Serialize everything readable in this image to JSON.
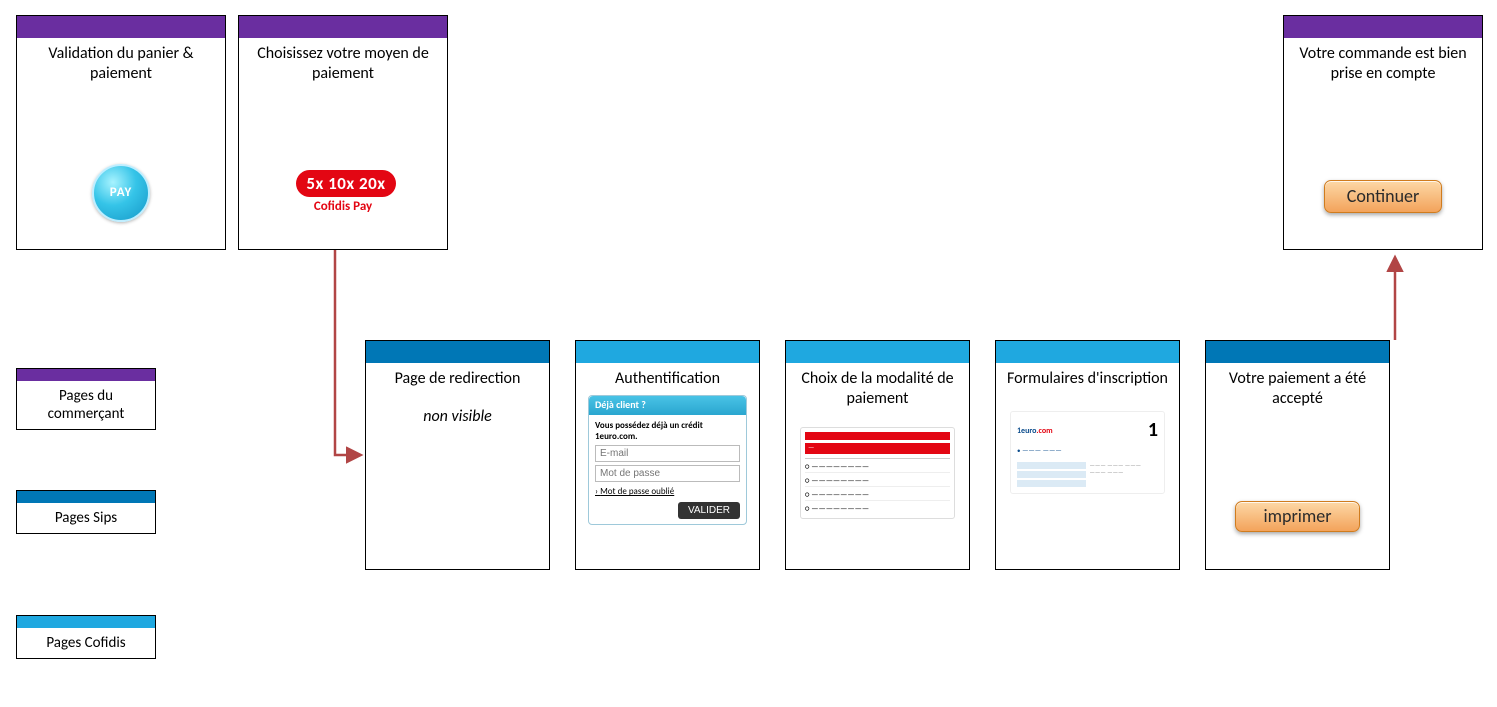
{
  "legend": {
    "merchant": "Pages du commerçant",
    "sips": "Pages Sips",
    "cofidis": "Pages Cofidis"
  },
  "topCards": {
    "validation": "Validation du panier & paiement",
    "choose": "Choisissez votre moyen de paiement",
    "confirm": "Votre commande est bien prise en compte",
    "continue": "Continuer"
  },
  "pay": {
    "label": "PAY"
  },
  "cofidisLogo": {
    "line1": "5x 10x 20x",
    "line2": "Cofidis Pay"
  },
  "bottomCards": {
    "redirect": {
      "title": "Page de redirection",
      "subtitle": "non visible"
    },
    "auth": {
      "title": "Authentification",
      "panelHead": "Déjà client ?",
      "panelText": "Vous possédez déjà un crédit 1euro.com.",
      "email": "E-mail",
      "password": "Mot de passe",
      "forgot": "Mot de passe oublié",
      "submit": "VALIDER"
    },
    "choice": "Choix de la modalité de paiement",
    "forms": "Formulaires d'inscription",
    "accepted": {
      "title": "Votre paiement a été accepté",
      "print": "imprimer"
    }
  },
  "colors": {
    "purple": "#6a2ea0",
    "sips": "#0077b6",
    "cofidis": "#1fa8e0",
    "arrow": "#b14545"
  }
}
